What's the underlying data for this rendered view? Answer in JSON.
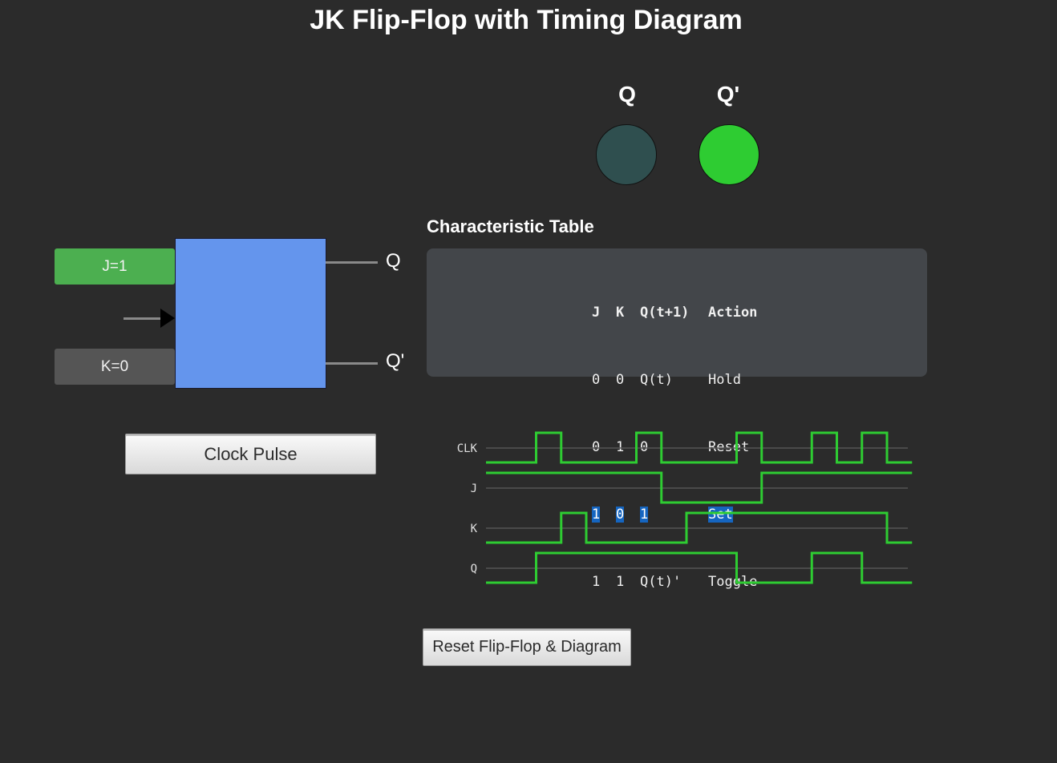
{
  "title": "JK Flip-Flop with Timing Diagram",
  "outputs": {
    "q_label": "Q",
    "qbar_label": "Q'",
    "q_state": 0,
    "qbar_state": 1,
    "on_color": "#2ecc32",
    "off_color": "#2f4f4f"
  },
  "flipflop": {
    "j_button": "J=1",
    "k_button": "K=0",
    "q_out": "Q",
    "qbar_out": "Q'",
    "box_color": "#6495ed"
  },
  "clock_button": "Clock Pulse",
  "table": {
    "heading": "Characteristic Table",
    "columns": [
      "J",
      "K",
      "Q(t+1)",
      "Action"
    ],
    "rows": [
      [
        "0",
        "0",
        "Q(t)",
        "Hold"
      ],
      [
        "0",
        "1",
        "0",
        "Reset"
      ],
      [
        "1",
        "0",
        "1",
        "Set"
      ],
      [
        "1",
        "1",
        "Q(t)'",
        "Toggle"
      ]
    ],
    "highlighted_row": 2
  },
  "timing": {
    "signals": [
      "CLK",
      "J",
      "K",
      "Q"
    ],
    "trace_color": "#2ecc32",
    "steps": 17,
    "waves": {
      "CLK": [
        0,
        0,
        1,
        0,
        0,
        0,
        1,
        0,
        0,
        0,
        1,
        0,
        0,
        1,
        0,
        1,
        0
      ],
      "J": [
        1,
        1,
        1,
        1,
        1,
        1,
        1,
        0,
        0,
        0,
        0,
        1,
        1,
        1,
        1,
        1,
        1
      ],
      "K": [
        0,
        0,
        0,
        1,
        0,
        0,
        0,
        0,
        1,
        1,
        1,
        1,
        1,
        1,
        1,
        1,
        0
      ],
      "Q": [
        0,
        0,
        1,
        1,
        1,
        1,
        1,
        1,
        1,
        1,
        0,
        0,
        0,
        1,
        1,
        0,
        0
      ]
    }
  },
  "reset_button": "Reset Flip-Flop & Diagram"
}
